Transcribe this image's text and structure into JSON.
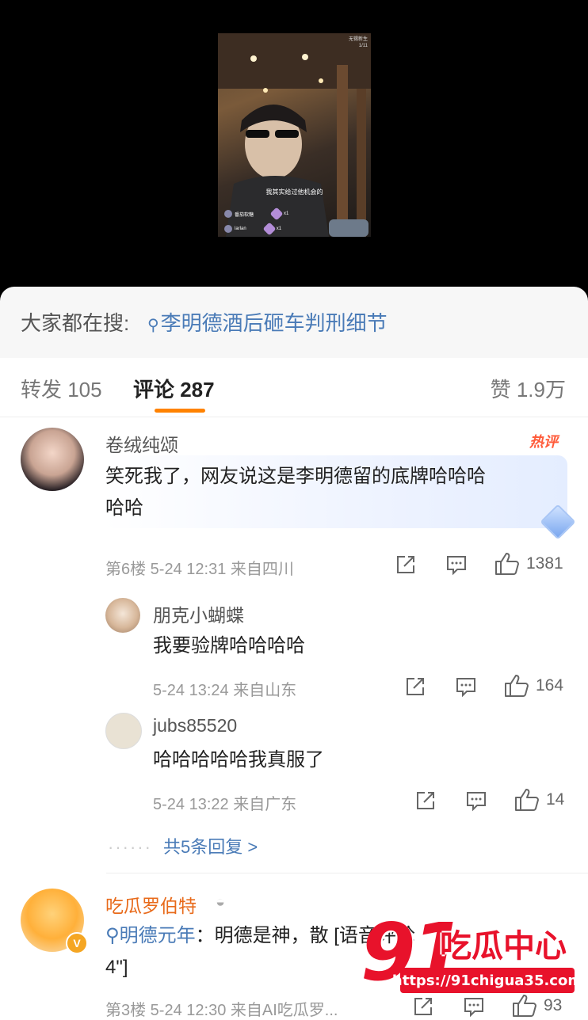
{
  "video": {
    "watermark_line1": "无锡新生",
    "watermark_line2": "1/11",
    "caption": "我其实给过他机会的",
    "gifts": [
      {
        "user": "番茄软糖",
        "count": "x1"
      },
      {
        "user": "larlan",
        "count": "x1"
      }
    ]
  },
  "search": {
    "label": "大家都在搜:",
    "term": "李明德酒后砸车判刑细节"
  },
  "tabs": {
    "repost": "转发 105",
    "comment": "评论 287",
    "like": "赞 1.9万"
  },
  "comments": [
    {
      "user": "卷绒纯颂",
      "badge": "热评",
      "text_line1": "笑死我了，网友说这是李明德留的底牌哈哈哈",
      "text_line2": "哈哈",
      "meta": "第6楼 5-24 12:31 来自四川",
      "likes": "1381",
      "replies": [
        {
          "user": "朋克小蝴蝶",
          "text": "我要验牌哈哈哈哈",
          "meta": "5-24 13:24 来自山东",
          "likes": "164"
        },
        {
          "user": "jubs85520",
          "text": "哈哈哈哈哈我真服了",
          "meta": "5-24 13:22 来自广东",
          "likes": "14"
        }
      ],
      "more_replies": "共5条回复 >"
    },
    {
      "user": "吃瓜罗伯特",
      "topic": "明德元年",
      "text_rest": "：明德是神，散",
      "text_tail": "[语音评论",
      "text_line2": "4\"]",
      "meta": "第3楼 5-24 12:30 来自AI吃瓜罗...",
      "likes": "93"
    }
  ],
  "watermark": {
    "number": "91",
    "name": "吃瓜中心",
    "url": "https://91chigua35.com"
  },
  "colors": {
    "accent": "#ff8200",
    "link": "#4a7bb7",
    "hot": "#ff5b3a",
    "brand_red": "#e8122b"
  }
}
